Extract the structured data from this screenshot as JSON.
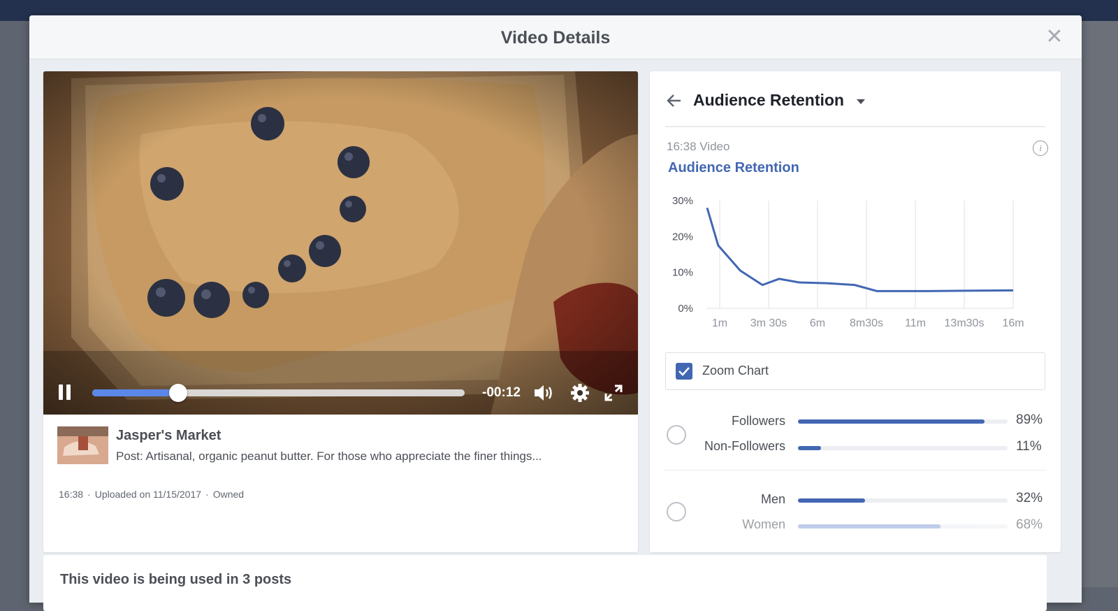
{
  "modal": {
    "title": "Video Details",
    "close_icon": "close-icon"
  },
  "player": {
    "time_remaining": "-00:12",
    "progress": 0.23,
    "icons": [
      "pause-icon",
      "volume-icon",
      "gear-icon",
      "fullscreen-icon"
    ]
  },
  "post": {
    "page_name": "Jasper's Market",
    "text": "Post: Artisanal, organic peanut butter. For those who appreciate the finer things...",
    "duration": "16:38",
    "uploaded": "Uploaded on 11/15/2017",
    "ownership": "Owned"
  },
  "retention": {
    "header_title": "Audience Retention",
    "video_length": "16:38 Video",
    "chart_title": "Audience Retention",
    "zoom_label": "Zoom Chart",
    "zoom_checked": true,
    "accent_color": "#4267b2",
    "groups": [
      {
        "selected": false,
        "rows": [
          {
            "label": "Followers",
            "value": 0.89,
            "pct": "89%",
            "color": "#4267b2"
          },
          {
            "label": "Non-Followers",
            "value": 0.11,
            "pct": "11%",
            "color": "#4267b2"
          }
        ]
      },
      {
        "selected": false,
        "rows": [
          {
            "label": "Men",
            "value": 0.32,
            "pct": "32%",
            "color": "#4267b2"
          },
          {
            "label": "Women",
            "value": 0.68,
            "pct": "68%",
            "color": "#8ea6d9"
          }
        ]
      }
    ]
  },
  "chart_data": {
    "type": "line",
    "title": "Audience Retention",
    "xlabel": "",
    "ylabel": "",
    "x_ticks": [
      "1m",
      "3m 30s",
      "6m",
      "8m30s",
      "11m",
      "13m30s",
      "16m"
    ],
    "y_ticks": [
      "30%",
      "20%",
      "10%",
      "0%"
    ],
    "xlim": [
      0,
      16.6
    ],
    "ylim": [
      0,
      30
    ],
    "grid": true,
    "series": [
      {
        "x": [
          0,
          0.6,
          1.8,
          3.0,
          3.9,
          5.0,
          6.5,
          8.0,
          9.2,
          10.5,
          12.0,
          14.0,
          16.6
        ],
        "values": [
          28,
          17.5,
          10.5,
          6.5,
          8.2,
          7.2,
          7.0,
          6.5,
          4.8,
          4.8,
          4.8,
          4.9,
          5.0
        ],
        "color": "#4267b2"
      }
    ]
  },
  "bottom": {
    "text": "This video is being used in 3 posts"
  }
}
